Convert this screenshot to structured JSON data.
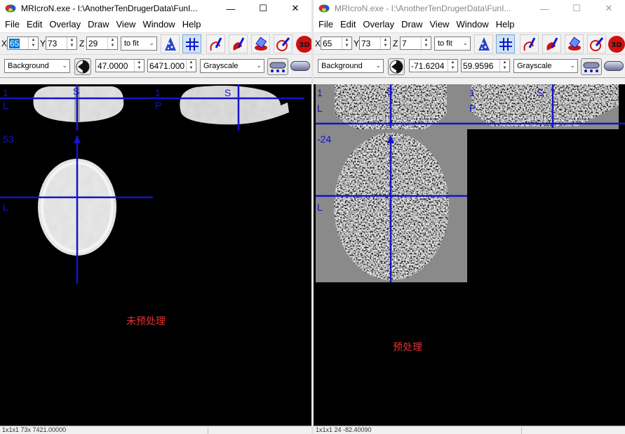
{
  "window_left": {
    "title": "MRIcroN.exe - I:\\AnotherTenDrugerData\\FunI...",
    "menu": [
      "File",
      "Edit",
      "Overlay",
      "Draw",
      "View",
      "Window",
      "Help"
    ],
    "coords": {
      "x_label": "X",
      "x": "65",
      "y_label": "Y",
      "y": "73",
      "z_label": "Z",
      "z": "29"
    },
    "zoom": "to fit",
    "layer": "Background",
    "min": "47.0000",
    "max": "6471.000",
    "colormap": "Grayscale",
    "view_labels": {
      "coronal_top": "1",
      "coronal_left": "L",
      "coronal_sup": "S",
      "sagittal_top": "1",
      "sagittal_left": "P",
      "sagittal_sup": "S",
      "axial_slice": "53",
      "axial_left": "L"
    },
    "caption": "未预处理",
    "status": "1x1x1 73x 7421.00000"
  },
  "window_right": {
    "title": "MRIcroN.exe - I:\\AnotherTenDrugerData\\FunI...",
    "menu": [
      "File",
      "Edit",
      "Overlay",
      "Draw",
      "View",
      "Window",
      "Help"
    ],
    "coords": {
      "x_label": "X",
      "x": "65",
      "y_label": "Y",
      "y": "73",
      "z_label": "Z",
      "z": "7"
    },
    "zoom": "to fit",
    "layer": "Background",
    "min": "-71.6204",
    "max": "59.9596",
    "colormap": "Grayscale",
    "view_labels": {
      "coronal_top": "1",
      "coronal_left": "L",
      "coronal_sup": "S",
      "sagittal_top": "1",
      "sagittal_left": "P",
      "sagittal_sup": "S",
      "axial_slice": "-24",
      "axial_left": "L"
    },
    "caption": "预处理",
    "status": "1x1x1 24 -82.40090"
  },
  "colors": {
    "crosshair": "#1414c8",
    "caption": "#e23232",
    "viewer_bg": "#000000"
  },
  "icons": [
    "brain-icon",
    "minimize-icon",
    "maximize-icon",
    "close-icon",
    "cone-icon",
    "crosshair-grid-icon",
    "draw-pen-icon",
    "draw-pen-filled-icon",
    "eraser-icon",
    "fill-pen-icon",
    "render-3d-icon",
    "contrast-arrow-icon",
    "colorbar-icon"
  ]
}
